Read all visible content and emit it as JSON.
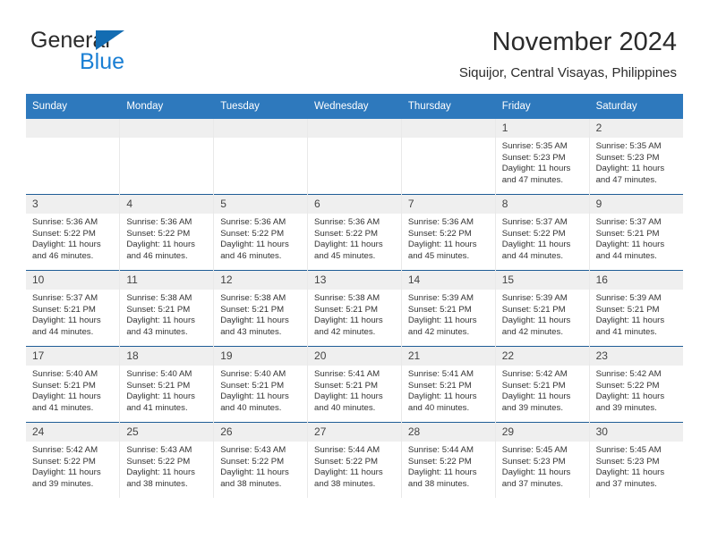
{
  "brand": {
    "name_line1": "General",
    "name_line2": "Blue",
    "triangle_icon": "blue-triangle-logo-mark",
    "color_dark": "#2b2b2b",
    "color_blue": "#1a7fd4"
  },
  "header": {
    "title": "November 2024",
    "subtitle": "Siquijor, Central Visayas, Philippines"
  },
  "theme": {
    "header_row_bg": "#2e79bd",
    "header_row_text": "#ffffff",
    "daynum_bg": "#efefef",
    "row_rule": "#1f5d96",
    "cell_divider": "#e9e9e9"
  },
  "weekday_headers": [
    "Sunday",
    "Monday",
    "Tuesday",
    "Wednesday",
    "Thursday",
    "Friday",
    "Saturday"
  ],
  "weeks": [
    [
      {
        "day": "",
        "empty": true
      },
      {
        "day": "",
        "empty": true
      },
      {
        "day": "",
        "empty": true
      },
      {
        "day": "",
        "empty": true
      },
      {
        "day": "",
        "empty": true
      },
      {
        "day": "1",
        "sunrise": "Sunrise: 5:35 AM",
        "sunset": "Sunset: 5:23 PM",
        "daylight_line1": "Daylight: 11 hours",
        "daylight_line2": "and 47 minutes."
      },
      {
        "day": "2",
        "sunrise": "Sunrise: 5:35 AM",
        "sunset": "Sunset: 5:23 PM",
        "daylight_line1": "Daylight: 11 hours",
        "daylight_line2": "and 47 minutes."
      }
    ],
    [
      {
        "day": "3",
        "sunrise": "Sunrise: 5:36 AM",
        "sunset": "Sunset: 5:22 PM",
        "daylight_line1": "Daylight: 11 hours",
        "daylight_line2": "and 46 minutes."
      },
      {
        "day": "4",
        "sunrise": "Sunrise: 5:36 AM",
        "sunset": "Sunset: 5:22 PM",
        "daylight_line1": "Daylight: 11 hours",
        "daylight_line2": "and 46 minutes."
      },
      {
        "day": "5",
        "sunrise": "Sunrise: 5:36 AM",
        "sunset": "Sunset: 5:22 PM",
        "daylight_line1": "Daylight: 11 hours",
        "daylight_line2": "and 46 minutes."
      },
      {
        "day": "6",
        "sunrise": "Sunrise: 5:36 AM",
        "sunset": "Sunset: 5:22 PM",
        "daylight_line1": "Daylight: 11 hours",
        "daylight_line2": "and 45 minutes."
      },
      {
        "day": "7",
        "sunrise": "Sunrise: 5:36 AM",
        "sunset": "Sunset: 5:22 PM",
        "daylight_line1": "Daylight: 11 hours",
        "daylight_line2": "and 45 minutes."
      },
      {
        "day": "8",
        "sunrise": "Sunrise: 5:37 AM",
        "sunset": "Sunset: 5:22 PM",
        "daylight_line1": "Daylight: 11 hours",
        "daylight_line2": "and 44 minutes."
      },
      {
        "day": "9",
        "sunrise": "Sunrise: 5:37 AM",
        "sunset": "Sunset: 5:21 PM",
        "daylight_line1": "Daylight: 11 hours",
        "daylight_line2": "and 44 minutes."
      }
    ],
    [
      {
        "day": "10",
        "sunrise": "Sunrise: 5:37 AM",
        "sunset": "Sunset: 5:21 PM",
        "daylight_line1": "Daylight: 11 hours",
        "daylight_line2": "and 44 minutes."
      },
      {
        "day": "11",
        "sunrise": "Sunrise: 5:38 AM",
        "sunset": "Sunset: 5:21 PM",
        "daylight_line1": "Daylight: 11 hours",
        "daylight_line2": "and 43 minutes."
      },
      {
        "day": "12",
        "sunrise": "Sunrise: 5:38 AM",
        "sunset": "Sunset: 5:21 PM",
        "daylight_line1": "Daylight: 11 hours",
        "daylight_line2": "and 43 minutes."
      },
      {
        "day": "13",
        "sunrise": "Sunrise: 5:38 AM",
        "sunset": "Sunset: 5:21 PM",
        "daylight_line1": "Daylight: 11 hours",
        "daylight_line2": "and 42 minutes."
      },
      {
        "day": "14",
        "sunrise": "Sunrise: 5:39 AM",
        "sunset": "Sunset: 5:21 PM",
        "daylight_line1": "Daylight: 11 hours",
        "daylight_line2": "and 42 minutes."
      },
      {
        "day": "15",
        "sunrise": "Sunrise: 5:39 AM",
        "sunset": "Sunset: 5:21 PM",
        "daylight_line1": "Daylight: 11 hours",
        "daylight_line2": "and 42 minutes."
      },
      {
        "day": "16",
        "sunrise": "Sunrise: 5:39 AM",
        "sunset": "Sunset: 5:21 PM",
        "daylight_line1": "Daylight: 11 hours",
        "daylight_line2": "and 41 minutes."
      }
    ],
    [
      {
        "day": "17",
        "sunrise": "Sunrise: 5:40 AM",
        "sunset": "Sunset: 5:21 PM",
        "daylight_line1": "Daylight: 11 hours",
        "daylight_line2": "and 41 minutes."
      },
      {
        "day": "18",
        "sunrise": "Sunrise: 5:40 AM",
        "sunset": "Sunset: 5:21 PM",
        "daylight_line1": "Daylight: 11 hours",
        "daylight_line2": "and 41 minutes."
      },
      {
        "day": "19",
        "sunrise": "Sunrise: 5:40 AM",
        "sunset": "Sunset: 5:21 PM",
        "daylight_line1": "Daylight: 11 hours",
        "daylight_line2": "and 40 minutes."
      },
      {
        "day": "20",
        "sunrise": "Sunrise: 5:41 AM",
        "sunset": "Sunset: 5:21 PM",
        "daylight_line1": "Daylight: 11 hours",
        "daylight_line2": "and 40 minutes."
      },
      {
        "day": "21",
        "sunrise": "Sunrise: 5:41 AM",
        "sunset": "Sunset: 5:21 PM",
        "daylight_line1": "Daylight: 11 hours",
        "daylight_line2": "and 40 minutes."
      },
      {
        "day": "22",
        "sunrise": "Sunrise: 5:42 AM",
        "sunset": "Sunset: 5:21 PM",
        "daylight_line1": "Daylight: 11 hours",
        "daylight_line2": "and 39 minutes."
      },
      {
        "day": "23",
        "sunrise": "Sunrise: 5:42 AM",
        "sunset": "Sunset: 5:22 PM",
        "daylight_line1": "Daylight: 11 hours",
        "daylight_line2": "and 39 minutes."
      }
    ],
    [
      {
        "day": "24",
        "sunrise": "Sunrise: 5:42 AM",
        "sunset": "Sunset: 5:22 PM",
        "daylight_line1": "Daylight: 11 hours",
        "daylight_line2": "and 39 minutes."
      },
      {
        "day": "25",
        "sunrise": "Sunrise: 5:43 AM",
        "sunset": "Sunset: 5:22 PM",
        "daylight_line1": "Daylight: 11 hours",
        "daylight_line2": "and 38 minutes."
      },
      {
        "day": "26",
        "sunrise": "Sunrise: 5:43 AM",
        "sunset": "Sunset: 5:22 PM",
        "daylight_line1": "Daylight: 11 hours",
        "daylight_line2": "and 38 minutes."
      },
      {
        "day": "27",
        "sunrise": "Sunrise: 5:44 AM",
        "sunset": "Sunset: 5:22 PM",
        "daylight_line1": "Daylight: 11 hours",
        "daylight_line2": "and 38 minutes."
      },
      {
        "day": "28",
        "sunrise": "Sunrise: 5:44 AM",
        "sunset": "Sunset: 5:22 PM",
        "daylight_line1": "Daylight: 11 hours",
        "daylight_line2": "and 38 minutes."
      },
      {
        "day": "29",
        "sunrise": "Sunrise: 5:45 AM",
        "sunset": "Sunset: 5:23 PM",
        "daylight_line1": "Daylight: 11 hours",
        "daylight_line2": "and 37 minutes."
      },
      {
        "day": "30",
        "sunrise": "Sunrise: 5:45 AM",
        "sunset": "Sunset: 5:23 PM",
        "daylight_line1": "Daylight: 11 hours",
        "daylight_line2": "and 37 minutes."
      }
    ]
  ]
}
